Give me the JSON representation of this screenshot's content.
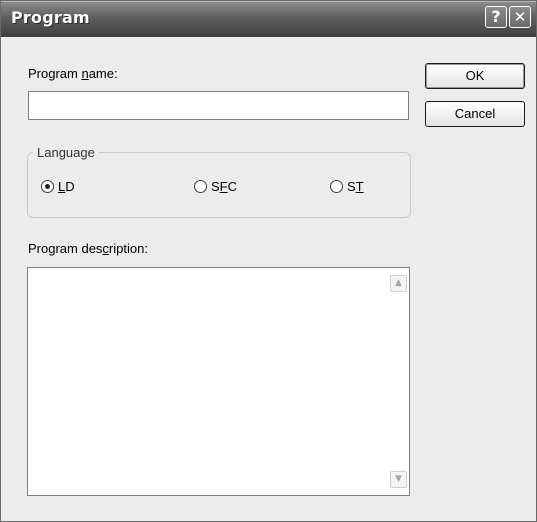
{
  "window": {
    "title": "Program",
    "help_glyph": "?",
    "close_glyph": "✕"
  },
  "form": {
    "name_label_pre": "Program ",
    "name_label_accel": "n",
    "name_label_post": "ame:",
    "name_value": "",
    "description_label_pre": "Program des",
    "description_label_accel": "c",
    "description_label_post": "ription:",
    "description_value": ""
  },
  "buttons": {
    "ok": "OK",
    "cancel": "Cancel"
  },
  "language": {
    "legend": "Language",
    "selected": "LD",
    "options": [
      {
        "pre": "",
        "accel": "L",
        "post": "D",
        "checked": true
      },
      {
        "pre": "S",
        "accel": "F",
        "post": "C",
        "checked": false
      },
      {
        "pre": "S",
        "accel": "T",
        "post": "",
        "checked": false
      }
    ]
  },
  "scrollbar": {
    "up_glyph": "▲",
    "down_glyph": "▼"
  }
}
